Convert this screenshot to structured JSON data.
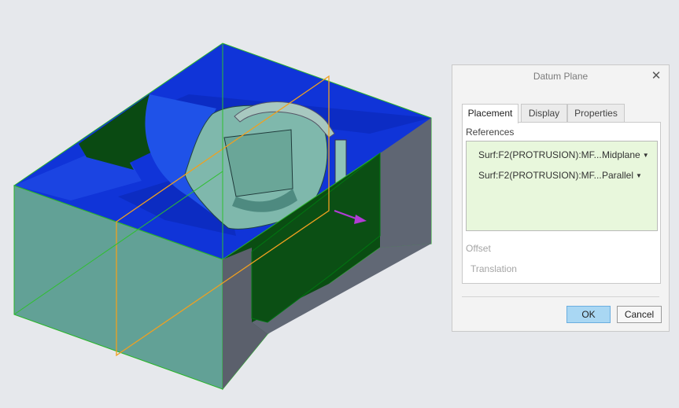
{
  "viewport": {
    "model": "mold-cavity-part",
    "colors": {
      "front_face": "#5f9c90",
      "top_face": "#0c2fd0",
      "dark_wall": "#0b4a10",
      "gray_wall": "#5e6470",
      "datum_frame": "#f0a020",
      "datum_green": "#2fbf2f",
      "arrow": "#b23cd6"
    }
  },
  "dialog": {
    "title": "Datum Plane",
    "close_icon": "close-icon",
    "tabs": [
      {
        "label": "Placement",
        "active": true
      },
      {
        "label": "Display",
        "active": false
      },
      {
        "label": "Properties",
        "active": false
      }
    ],
    "references_label": "References",
    "references": [
      {
        "name": "Surf:F2(PROTRUSION):MF...",
        "constraint": "Midplane"
      },
      {
        "name": "Surf:F2(PROTRUSION):MF...",
        "constraint": "Parallel"
      }
    ],
    "offset_label": "Offset",
    "translation_label": "Translation",
    "ok_label": "OK",
    "cancel_label": "Cancel"
  }
}
